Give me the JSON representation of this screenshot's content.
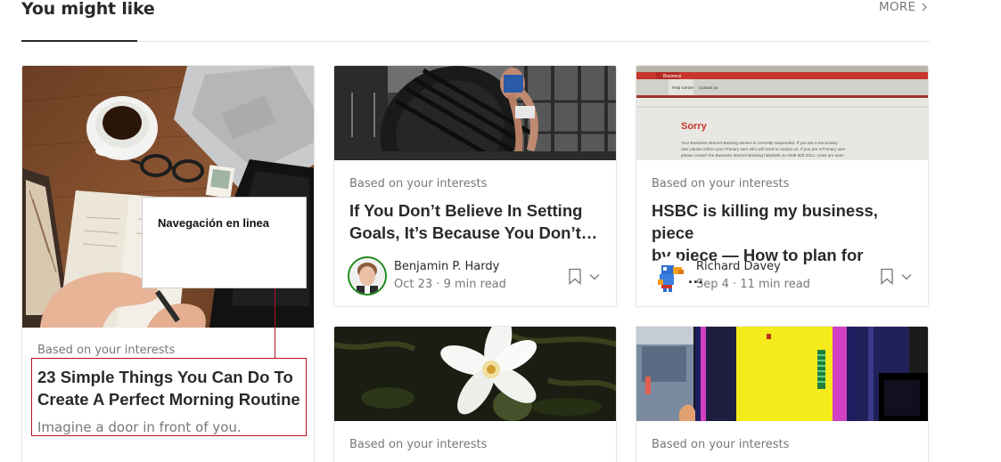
{
  "section": {
    "title": "You might like",
    "more_label": "MORE"
  },
  "cards": [
    {
      "kicker": "Based on your interests",
      "title_line1": "23 Simple Things You Can Do To",
      "title_line2": "Create A Perfect Morning Routine",
      "subtitle": "Imagine a door in front of you."
    },
    {
      "kicker": "Based on your interests",
      "title_line1": "If You Don’t Believe In Setting",
      "title_line2": "Goals, It’s Because You Don’t…",
      "author": "Benjamin P. Hardy",
      "date": "Oct 23",
      "read_time": "9 min read"
    },
    {
      "kicker": "Based on your interests",
      "title_line1": "HSBC is killing my business, piece",
      "title_line2": "by piece — How to plan for your…",
      "author": "Richard Davey",
      "date": "Sep 4",
      "read_time": "11 min read",
      "image_text": {
        "tab1": "Business",
        "tab2": "Help Centre",
        "tab3": "Contact us",
        "heading": "Sorry",
        "body1": "Your Business Internet Banking service is currently suspended. If you are a Secondary",
        "body2": "user please inform your Primary user who will need to contact us. If you are a Primary user",
        "body3": "please contact the Business Internet Banking helpdesk on 0345 600 2314. Lines are open"
      }
    },
    {
      "kicker": "Based on your interests"
    },
    {
      "kicker": "Based on your interests"
    }
  ],
  "meta_separator": "·",
  "annotation": {
    "label": "Navegación en linea"
  },
  "colors": {
    "annotation_red": "#b3121e",
    "avatar_ring": "#1a8917"
  }
}
